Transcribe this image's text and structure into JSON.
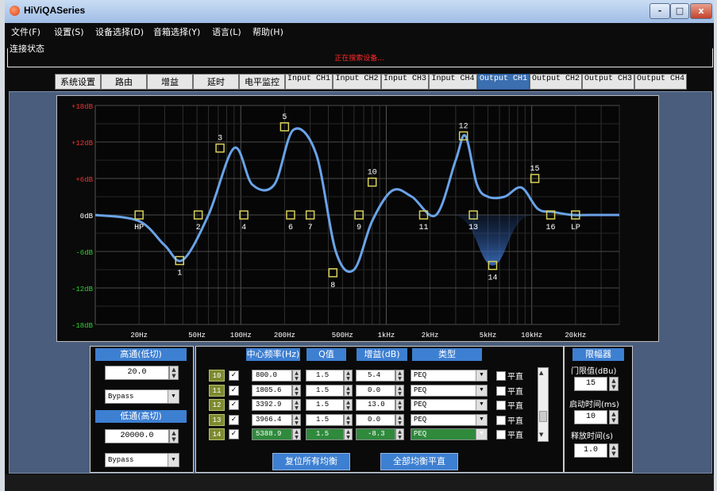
{
  "window": {
    "title": "HiViQASeries",
    "minimize": "-",
    "maximize": "□",
    "close": "x"
  },
  "menu": [
    "文件(F)",
    "设置(S)",
    "设备选择(D)",
    "音箱选择(Y)",
    "语言(L)",
    "帮助(H)"
  ],
  "connection": {
    "label": "连接状态",
    "status": "正在搜索设备..."
  },
  "tabs": [
    "系统设置",
    "路由",
    "增益",
    "延时",
    "电平监控",
    "Input CH1",
    "Input CH2",
    "Input CH3",
    "Input CH4",
    "Output CH1",
    "Output CH2",
    "Output CH3",
    "Output CH4"
  ],
  "active_tab": "Output CH1",
  "chart": {
    "y_ticks": [
      "+18dB",
      "+12dB",
      "+6dB",
      "0dB",
      "-6dB",
      "-12dB",
      "-18dB"
    ],
    "x_ticks": [
      "20Hz",
      "50Hz",
      "100Hz",
      "200Hz",
      "500Hz",
      "1kHz",
      "2kHz",
      "5kHz",
      "10kHz",
      "20kHz"
    ],
    "curve_color": "#6aa3e8",
    "marker_color": "#d8d05a"
  },
  "chart_data": {
    "type": "line",
    "xlabel": "",
    "ylabel": "",
    "x_scale": "log",
    "xlim_hz": [
      10,
      40000
    ],
    "ylim_db": [
      -18,
      18
    ],
    "series": [
      {
        "x_hz": [
          10,
          20,
          30,
          40,
          60,
          90,
          120,
          170,
          230,
          330,
          450,
          600,
          800,
          1100,
          1500,
          2200,
          3000,
          3500,
          4200,
          5000,
          6500,
          8500,
          11000,
          14000,
          19000,
          25000,
          40000
        ],
        "y_db": [
          0,
          -1,
          -5,
          -7.4,
          0,
          11,
          5,
          5,
          14,
          10,
          -6,
          -9,
          -1,
          4,
          3,
          0,
          9,
          13,
          5,
          3,
          3,
          4.5,
          1,
          0.5,
          0,
          0,
          0
        ]
      }
    ],
    "markers": [
      {
        "label": "HP",
        "freq_hz": 20,
        "gain_db": 0
      },
      {
        "label": "1",
        "freq_hz": 38,
        "gain_db": -7.5
      },
      {
        "label": "2",
        "freq_hz": 51,
        "gain_db": 0
      },
      {
        "label": "3",
        "freq_hz": 72,
        "gain_db": 11
      },
      {
        "label": "4",
        "freq_hz": 105,
        "gain_db": 0
      },
      {
        "label": "5",
        "freq_hz": 200,
        "gain_db": 14.5
      },
      {
        "label": "6",
        "freq_hz": 220,
        "gain_db": 0
      },
      {
        "label": "7",
        "freq_hz": 300,
        "gain_db": 0
      },
      {
        "label": "8",
        "freq_hz": 430,
        "gain_db": -9.5
      },
      {
        "label": "9",
        "freq_hz": 650,
        "gain_db": 0
      },
      {
        "label": "10",
        "freq_hz": 800,
        "gain_db": 5.4
      },
      {
        "label": "11",
        "freq_hz": 1805.6,
        "gain_db": 0
      },
      {
        "label": "12",
        "freq_hz": 3392.9,
        "gain_db": 13
      },
      {
        "label": "13",
        "freq_hz": 3966.4,
        "gain_db": 0
      },
      {
        "label": "14",
        "freq_hz": 5388.9,
        "gain_db": -8.3
      },
      {
        "label": "15",
        "freq_hz": 10500,
        "gain_db": 6
      },
      {
        "label": "16",
        "freq_hz": 13500,
        "gain_db": 0
      },
      {
        "label": "LP",
        "freq_hz": 20000,
        "gain_db": 0
      }
    ]
  },
  "hpf": {
    "header": "高通(低切)",
    "freq": "20.0",
    "type": "Bypass"
  },
  "lpf": {
    "header": "低通(高切)",
    "freq": "20000.0",
    "type": "Bypass"
  },
  "peq": {
    "headers": {
      "freq": "中心频率(Hz)",
      "q": "Q值",
      "gain": "增益(dB)",
      "type": "类型"
    },
    "rows": [
      {
        "idx": "10",
        "freq": "800.0",
        "q": "1.5",
        "gain": "5.4",
        "type": "PEQ",
        "flat": "平直",
        "selected": false
      },
      {
        "idx": "11",
        "freq": "1805.6",
        "q": "1.5",
        "gain": "0.0",
        "type": "PEQ",
        "flat": "平直",
        "selected": false
      },
      {
        "idx": "12",
        "freq": "3392.9",
        "q": "1.5",
        "gain": "13.0",
        "type": "PEQ",
        "flat": "平直",
        "selected": false
      },
      {
        "idx": "13",
        "freq": "3966.4",
        "q": "1.5",
        "gain": "0.0",
        "type": "PEQ",
        "flat": "平直",
        "selected": false
      },
      {
        "idx": "14",
        "freq": "5388.9",
        "q": "1.5",
        "gain": "-8.3",
        "type": "PEQ",
        "flat": "平直",
        "selected": true
      }
    ],
    "reset_label": "复位所有均衡",
    "flat_all_label": "全部均衡平直"
  },
  "limiter": {
    "header": "限幅器",
    "threshold_label": "门限值(dBu)",
    "threshold": "15",
    "attack_label": "启动时间(ms)",
    "attack": "10",
    "release_label": "释放时间(s)",
    "release": "1.0"
  }
}
